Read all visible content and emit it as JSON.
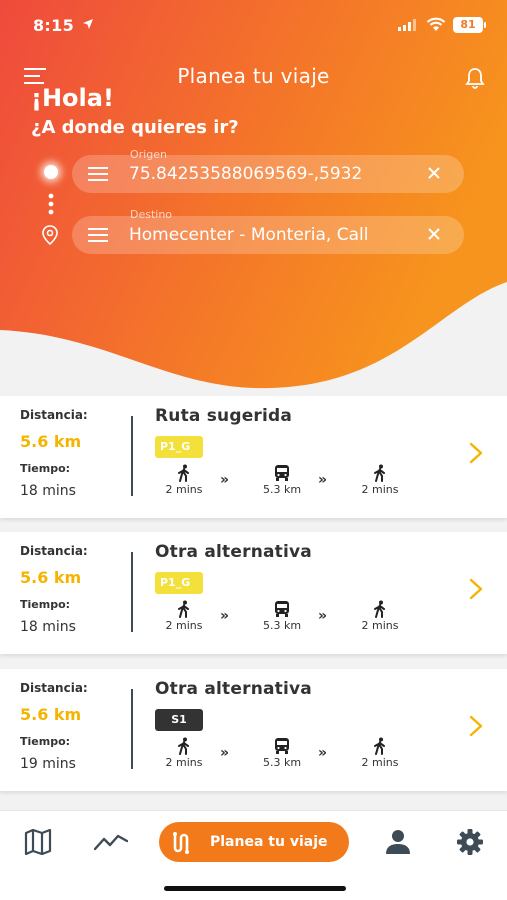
{
  "status_bar": {
    "time": "8:15",
    "battery": "81"
  },
  "header": {
    "title": "Planea tu viaje",
    "greeting": "¡Hola!",
    "question": "¿A donde quieres ir?"
  },
  "origin": {
    "label": "Origen",
    "value": "5932,-75.84253588069569"
  },
  "destination": {
    "label": "Destino",
    "value": "Homecenter - Monteria, Call"
  },
  "routes": [
    {
      "distance_label": "Distancia:",
      "distance": "5.6 km",
      "time_label": "Tiempo:",
      "time": "18 mins",
      "title": "Ruta sugerida",
      "badge": "P1_G",
      "badge_color": "#f3e03b",
      "segments": [
        {
          "icon": "walk-icon",
          "text": "2 mins"
        },
        {
          "icon": "bus-icon",
          "text": "5.3 km"
        },
        {
          "icon": "walk-icon",
          "text": "2 mins"
        }
      ]
    },
    {
      "distance_label": "Distancia:",
      "distance": "5.6 km",
      "time_label": "Tiempo:",
      "time": "18 mins",
      "title": "Otra alternativa",
      "badge": "P1_G",
      "badge_color": "#f3e03b",
      "segments": [
        {
          "icon": "walk-icon",
          "text": "2 mins"
        },
        {
          "icon": "bus-icon",
          "text": "5.3 km"
        },
        {
          "icon": "walk-icon",
          "text": "2 mins"
        }
      ]
    },
    {
      "distance_label": "Distancia:",
      "distance": "5.6 km",
      "time_label": "Tiempo:",
      "time": "19 mins",
      "title": "Otra alternativa",
      "badge": "S1",
      "badge_color": "#333333",
      "segments": [
        {
          "icon": "walk-icon",
          "text": "2 mins"
        },
        {
          "icon": "bus-icon",
          "text": "5.3 km"
        },
        {
          "icon": "walk-icon",
          "text": "2 mins"
        }
      ]
    }
  ],
  "separator": "»",
  "bottom_nav": {
    "items": [
      "map-icon",
      "chart-icon",
      "plan-trip-button",
      "profile-icon",
      "settings-icon"
    ],
    "active_label": "Planea tu viaje"
  },
  "colors": {
    "accent": "#f27a1a",
    "header_start": "#ef4c3c",
    "header_end": "#f7941d",
    "distance": "#f5b400"
  }
}
